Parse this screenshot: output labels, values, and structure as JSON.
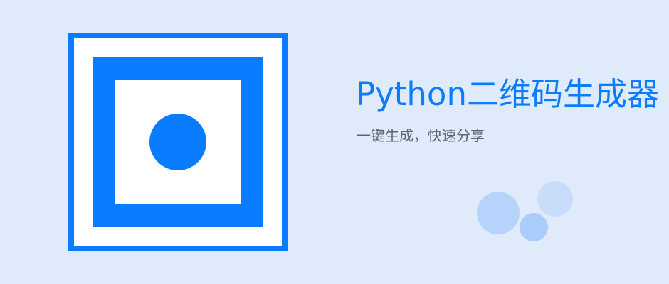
{
  "banner": {
    "title": "Python二维码生成器",
    "subtitle": "一键生成，快速分享"
  },
  "icons": {
    "logo": "qr-code-finder-pattern-icon",
    "decoration": "bubbles-decoration"
  },
  "colors": {
    "background": "#dfeafb",
    "accent": "#0a7cff",
    "subtitle_text": "#5b6470",
    "bubble_light": "#c9ddfb",
    "bubble_mid": "#b6d3fb",
    "bubble_dark": "#a9ccfb"
  }
}
